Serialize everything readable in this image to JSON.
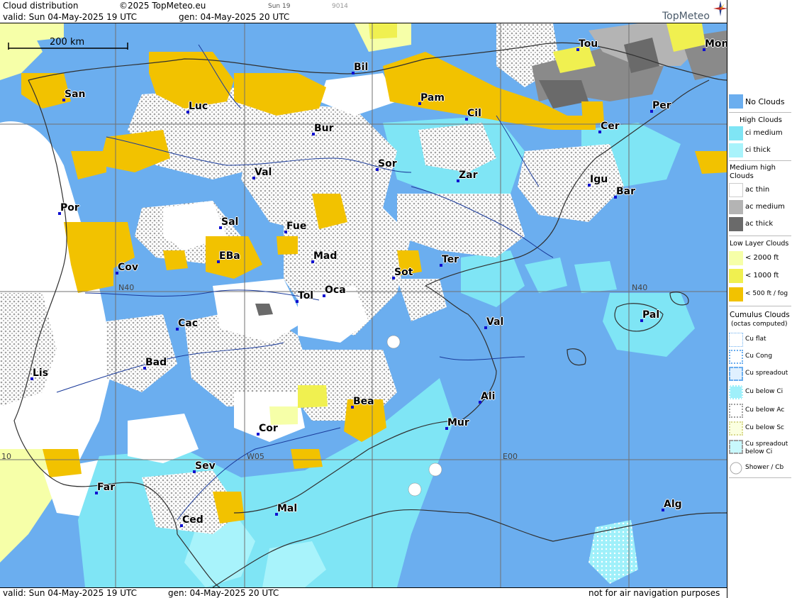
{
  "header": {
    "title": "Cloud distribution",
    "copyright": "©2025 TopMeteo.eu",
    "day": "Sun 19",
    "code": "9014",
    "valid": "valid:  Sun  04-May-2025  19 UTC",
    "gen": "gen: 04-May-2025 20 UTC",
    "brand": "TopMeteo"
  },
  "footer": {
    "valid": "valid:  Sun  04-May-2025  19 UTC",
    "gen": "gen: 04-May-2025 20 UTC",
    "note": "not for air navigation purposes"
  },
  "map": {
    "scale": "200 km",
    "grid_labels": [
      "N40",
      "N40",
      "W05",
      "E00",
      "10"
    ],
    "cities": [
      "Tou",
      "Mon",
      "Bil",
      "San",
      "Pam",
      "Luc",
      "Cil",
      "Per",
      "Cer",
      "Bur",
      "Sor",
      "Val",
      "Zar",
      "Igu",
      "Bar",
      "Por",
      "Sal",
      "Fue",
      "EBa",
      "Mad",
      "Cov",
      "Ter",
      "Sot",
      "Tol",
      "Oca",
      "Pal",
      "Val",
      "Cac",
      "Lis",
      "Bad",
      "Ali",
      "Bea",
      "Mur",
      "Cor",
      "Sev",
      "Far",
      "Mal",
      "Alg",
      "Ced"
    ]
  },
  "legend": {
    "no_clouds": "No Clouds",
    "high_clouds": "High Clouds",
    "ci_medium": "ci medium",
    "ci_thick": "ci thick",
    "medium_high": "Medium high Clouds",
    "ac_thin": "ac thin",
    "ac_medium": "ac medium",
    "ac_thick": "ac thick",
    "low_layer": "Low Layer Clouds",
    "lt2000": "< 2000 ft",
    "lt1000": "< 1000 ft",
    "lt500": "< 500 ft / fog",
    "cumulus": "Cumulus Clouds",
    "octas": "(octas computed)",
    "cu_flat": "Cu flat",
    "cu_cong": "Cu Cong",
    "cu_spreadout": "Cu spreadout",
    "cu_below_ci": "Cu below Ci",
    "cu_below_ac": "Cu below Ac",
    "cu_below_sc": "Cu below Sc",
    "cu_spreadout_below_ci": "Cu spreadout below Ci",
    "shower": "Shower / Cb"
  },
  "colors": {
    "no_clouds": "#6baeef",
    "ci_medium": "#7fe5f5",
    "ci_thick": "#a8f3fb",
    "ac_thin": "#ffffff",
    "ac_medium": "#b4b4b4",
    "ac_thick": "#7a7a7a",
    "low_2000": "#f6ffa8",
    "low_1000": "#f0f050",
    "low_500": "#f2c200"
  }
}
